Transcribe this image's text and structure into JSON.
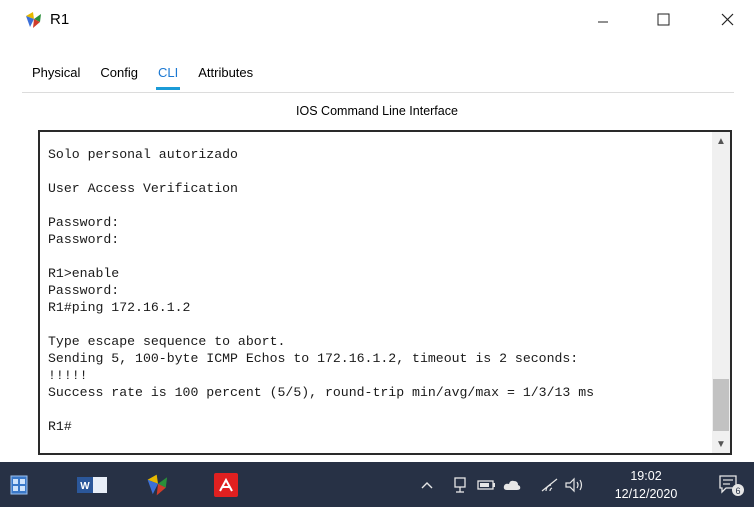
{
  "window": {
    "title": "R1",
    "app_icon": "packet-tracer-router-icon",
    "controls": [
      "minimize-icon",
      "maximize-icon",
      "close-icon"
    ]
  },
  "tabs": [
    {
      "label": "Physical",
      "active": false
    },
    {
      "label": "Config",
      "active": false
    },
    {
      "label": "CLI",
      "active": true
    },
    {
      "label": "Attributes",
      "active": false
    }
  ],
  "panel": {
    "title": "IOS Command Line Interface"
  },
  "terminal": {
    "lines": [
      "Solo personal autorizado",
      "",
      "User Access Verification",
      "",
      "Password:",
      "Password:",
      "",
      "R1>enable",
      "Password:",
      "R1#ping 172.16.1.2",
      "",
      "Type escape sequence to abort.",
      "Sending 5, 100-byte ICMP Echos to 172.16.1.2, timeout is 2 seconds:",
      "!!!!!",
      "Success rate is 100 percent (5/5), round-trip min/avg/max = 1/3/13 ms",
      "",
      "R1#"
    ]
  },
  "taskbar": {
    "items": [
      "task-view-icon",
      "word-icon",
      "packet-tracer-icon",
      "acrobat-icon"
    ],
    "tray_icons": [
      "chevron-up-icon",
      "device-icon",
      "battery-icon",
      "cloud-icon",
      "wifi-icon",
      "volume-icon"
    ],
    "time": "19:02",
    "date": "12/12/2020",
    "notification_count": "6"
  },
  "colors": {
    "accent": "#1b9bd7",
    "taskbar": "#273145",
    "word": "#2b579a",
    "acrobat": "#e02020"
  }
}
